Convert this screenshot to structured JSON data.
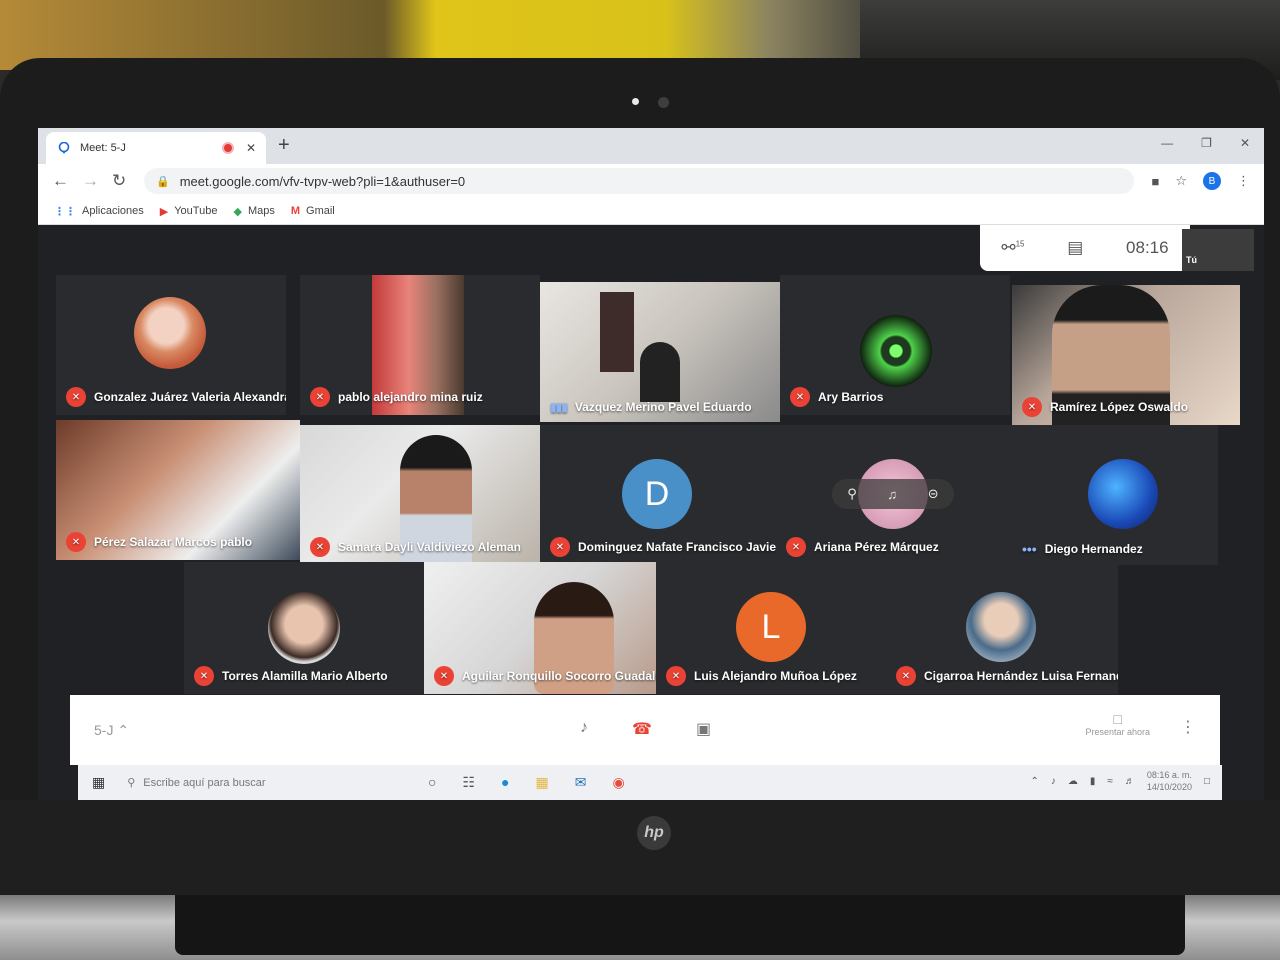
{
  "browser": {
    "tab_title": "Meet: 5-J",
    "tab_close": "✕",
    "new_tab": "+",
    "url": "meet.google.com/vfv-tvpv-web?pli=1&authuser=0",
    "profile_initial": "B",
    "bookmarks": [
      {
        "label": "Aplicaciones",
        "icon": "apps-grid-icon"
      },
      {
        "label": "YouTube",
        "icon": "youtube-icon"
      },
      {
        "label": "Maps",
        "icon": "maps-icon"
      },
      {
        "label": "Gmail",
        "icon": "gmail-icon"
      }
    ]
  },
  "meet": {
    "participant_count": "15",
    "time": "08:16",
    "self_label": "Tú",
    "participants": [
      {
        "name": "Gonzalez Juárez Valeria Alexandra",
        "status": "muted"
      },
      {
        "name": "pablo alejandro mina ruiz",
        "status": "muted"
      },
      {
        "name": "Vazquez Merino Pavel Eduardo",
        "status": "speaking"
      },
      {
        "name": "Ary Barrios",
        "status": "muted"
      },
      {
        "name": "Ramírez López Oswaldo",
        "status": "muted"
      },
      {
        "name": "Pérez Salazar Marcos pablo",
        "status": "muted"
      },
      {
        "name": "Samara Dayli Valdiviezo Aleman",
        "status": "muted"
      },
      {
        "name": "Dominguez Nafate Francisco Javier",
        "status": "muted",
        "initial": "D"
      },
      {
        "name": "Ariana Pérez Márquez",
        "status": "muted"
      },
      {
        "name": "Diego Hernandez",
        "status": "connecting"
      },
      {
        "name": "Torres Alamilla Mario Alberto",
        "status": "muted"
      },
      {
        "name": "Aguilar Ronquillo Socorro Guadalupe",
        "status": "muted"
      },
      {
        "name": "Luis Alejandro Muñoa López",
        "status": "muted",
        "initial": "L"
      },
      {
        "name": "Cigarroa Hernández Luisa Fernanda",
        "status": "muted"
      }
    ],
    "meeting_code": "5-J",
    "present_label": "Presentar ahora"
  },
  "taskbar": {
    "search_placeholder": "Escribe aquí para buscar",
    "time": "08:16 a. m.",
    "date": "14/10/2020"
  },
  "colors": {
    "mute_red": "#ea4335",
    "avatar_d": "#4a90c8",
    "avatar_l": "#e8692a",
    "meet_bg": "#202124"
  }
}
